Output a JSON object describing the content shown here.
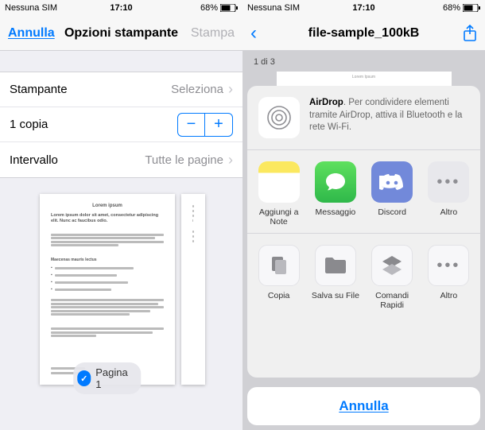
{
  "statusbar": {
    "carrier": "Nessuna SIM",
    "time": "17:10",
    "battery": "68%"
  },
  "left": {
    "nav": {
      "cancel": "Annulla",
      "title": "Opzioni stampante",
      "print": "Stampa"
    },
    "rows": {
      "printer_label": "Stampante",
      "printer_value": "Seleziona",
      "copies_label": "1 copia",
      "range_label": "Intervallo",
      "range_value": "Tutte le pagine"
    },
    "preview": {
      "doc_title": "Lorem ipsum",
      "doc_heading": "Lorem ipsum dolor sit amet, consectetur adipiscing elit. Nunc ac faucibus odio.",
      "page_label": "Pagina 1"
    }
  },
  "right": {
    "nav": {
      "title": "file-sample_100kB"
    },
    "pagecount": "1 di 3",
    "doc_title": "Lorem Ipsum",
    "airdrop": {
      "name": "AirDrop",
      "text": ". Per condividere elementi tramite AirDrop, attiva il Bluetooth e la rete Wi-Fi."
    },
    "apps": [
      {
        "label": "Aggiungi a Note"
      },
      {
        "label": "Messaggio"
      },
      {
        "label": "Discord"
      },
      {
        "label": "Altro"
      }
    ],
    "actions": [
      {
        "label": "Copia"
      },
      {
        "label": "Salva su File"
      },
      {
        "label": "Comandi Rapidi"
      },
      {
        "label": "Altro"
      }
    ],
    "cancel": "Annulla"
  }
}
